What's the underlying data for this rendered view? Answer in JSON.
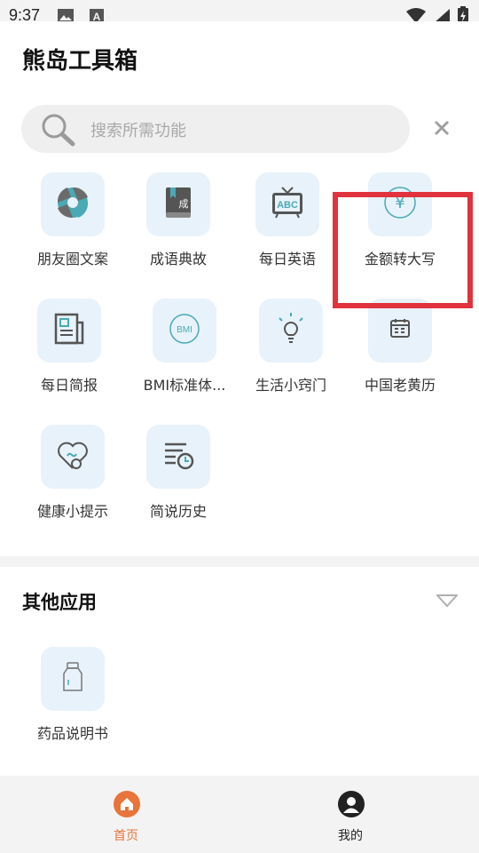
{
  "status_bar": {
    "time": "9:37",
    "icons": [
      "image-icon",
      "text-a-icon",
      "wifi-icon",
      "signal-icon",
      "battery-charging-icon"
    ]
  },
  "app": {
    "title": "熊岛工具箱"
  },
  "search": {
    "placeholder": "搜索所需功能",
    "icon": "search-icon",
    "clear_icon": "close-icon"
  },
  "tools": [
    {
      "label": "朋友圈文案",
      "icon": "aperture-icon"
    },
    {
      "label": "成语典故",
      "icon": "idiom-book-icon"
    },
    {
      "label": "每日英语",
      "icon": "abc-board-icon"
    },
    {
      "label": "金额转大写",
      "icon": "yen-icon",
      "highlighted": true
    },
    {
      "label": "每日简报",
      "icon": "newspaper-icon"
    },
    {
      "label": "BMI标准体...",
      "icon": "bmi-icon"
    },
    {
      "label": "生活小窍门",
      "icon": "lightbulb-icon"
    },
    {
      "label": "中国老黄历",
      "icon": "calendar-icon"
    },
    {
      "label": "健康小提示",
      "icon": "heart-stethoscope-icon"
    },
    {
      "label": "简说历史",
      "icon": "history-list-icon"
    }
  ],
  "other_apps": {
    "title": "其他应用",
    "items": [
      {
        "label": "药品说明书",
        "icon": "medicine-bottle-icon"
      }
    ]
  },
  "nav": {
    "items": [
      {
        "label": "首页",
        "icon": "home-icon",
        "active": true
      },
      {
        "label": "我的",
        "icon": "user-icon",
        "active": false
      }
    ]
  },
  "colors": {
    "accent": "#e8743b",
    "tile_bg": "#e8f2fa",
    "icon_teal": "#4aa9b4",
    "highlight": "#e0333d"
  }
}
